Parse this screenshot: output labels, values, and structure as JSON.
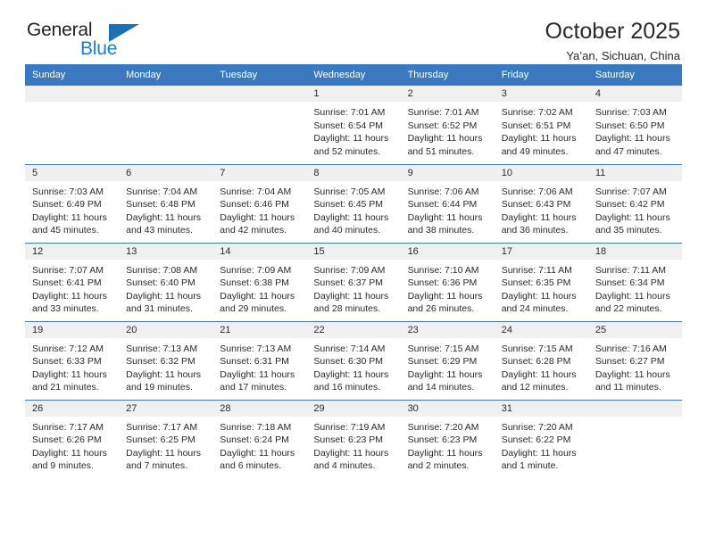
{
  "brand": {
    "name_top": "General",
    "name_bottom": "Blue",
    "triangle_color": "#1b6fb5",
    "blue_color": "#1b7fd0",
    "dark_color": "#231f20"
  },
  "header": {
    "title": "October 2025",
    "subtitle": "Ya’an, Sichuan, China"
  },
  "theme": {
    "header_row_bg": "#3a79c0",
    "header_row_text": "#ffffff",
    "daynum_band_bg": "#f0f0f0",
    "cell_border": "#3a79c0",
    "text": "#2a2a2a"
  },
  "calendar": {
    "weekday_headers": [
      "Sunday",
      "Monday",
      "Tuesday",
      "Wednesday",
      "Thursday",
      "Friday",
      "Saturday"
    ],
    "labels": {
      "sunrise": "Sunrise:",
      "sunset": "Sunset:",
      "daylight": "Daylight:"
    },
    "weeks": [
      [
        {
          "day": "",
          "sunrise": "",
          "sunset": "",
          "daylight": "",
          "empty": true
        },
        {
          "day": "",
          "sunrise": "",
          "sunset": "",
          "daylight": "",
          "empty": true
        },
        {
          "day": "",
          "sunrise": "",
          "sunset": "",
          "daylight": "",
          "empty": true
        },
        {
          "day": "1",
          "sunrise": "Sunrise: 7:01 AM",
          "sunset": "Sunset: 6:54 PM",
          "daylight": "Daylight: 11 hours and 52 minutes."
        },
        {
          "day": "2",
          "sunrise": "Sunrise: 7:01 AM",
          "sunset": "Sunset: 6:52 PM",
          "daylight": "Daylight: 11 hours and 51 minutes."
        },
        {
          "day": "3",
          "sunrise": "Sunrise: 7:02 AM",
          "sunset": "Sunset: 6:51 PM",
          "daylight": "Daylight: 11 hours and 49 minutes."
        },
        {
          "day": "4",
          "sunrise": "Sunrise: 7:03 AM",
          "sunset": "Sunset: 6:50 PM",
          "daylight": "Daylight: 11 hours and 47 minutes."
        }
      ],
      [
        {
          "day": "5",
          "sunrise": "Sunrise: 7:03 AM",
          "sunset": "Sunset: 6:49 PM",
          "daylight": "Daylight: 11 hours and 45 minutes."
        },
        {
          "day": "6",
          "sunrise": "Sunrise: 7:04 AM",
          "sunset": "Sunset: 6:48 PM",
          "daylight": "Daylight: 11 hours and 43 minutes."
        },
        {
          "day": "7",
          "sunrise": "Sunrise: 7:04 AM",
          "sunset": "Sunset: 6:46 PM",
          "daylight": "Daylight: 11 hours and 42 minutes."
        },
        {
          "day": "8",
          "sunrise": "Sunrise: 7:05 AM",
          "sunset": "Sunset: 6:45 PM",
          "daylight": "Daylight: 11 hours and 40 minutes."
        },
        {
          "day": "9",
          "sunrise": "Sunrise: 7:06 AM",
          "sunset": "Sunset: 6:44 PM",
          "daylight": "Daylight: 11 hours and 38 minutes."
        },
        {
          "day": "10",
          "sunrise": "Sunrise: 7:06 AM",
          "sunset": "Sunset: 6:43 PM",
          "daylight": "Daylight: 11 hours and 36 minutes."
        },
        {
          "day": "11",
          "sunrise": "Sunrise: 7:07 AM",
          "sunset": "Sunset: 6:42 PM",
          "daylight": "Daylight: 11 hours and 35 minutes."
        }
      ],
      [
        {
          "day": "12",
          "sunrise": "Sunrise: 7:07 AM",
          "sunset": "Sunset: 6:41 PM",
          "daylight": "Daylight: 11 hours and 33 minutes."
        },
        {
          "day": "13",
          "sunrise": "Sunrise: 7:08 AM",
          "sunset": "Sunset: 6:40 PM",
          "daylight": "Daylight: 11 hours and 31 minutes."
        },
        {
          "day": "14",
          "sunrise": "Sunrise: 7:09 AM",
          "sunset": "Sunset: 6:38 PM",
          "daylight": "Daylight: 11 hours and 29 minutes."
        },
        {
          "day": "15",
          "sunrise": "Sunrise: 7:09 AM",
          "sunset": "Sunset: 6:37 PM",
          "daylight": "Daylight: 11 hours and 28 minutes."
        },
        {
          "day": "16",
          "sunrise": "Sunrise: 7:10 AM",
          "sunset": "Sunset: 6:36 PM",
          "daylight": "Daylight: 11 hours and 26 minutes."
        },
        {
          "day": "17",
          "sunrise": "Sunrise: 7:11 AM",
          "sunset": "Sunset: 6:35 PM",
          "daylight": "Daylight: 11 hours and 24 minutes."
        },
        {
          "day": "18",
          "sunrise": "Sunrise: 7:11 AM",
          "sunset": "Sunset: 6:34 PM",
          "daylight": "Daylight: 11 hours and 22 minutes."
        }
      ],
      [
        {
          "day": "19",
          "sunrise": "Sunrise: 7:12 AM",
          "sunset": "Sunset: 6:33 PM",
          "daylight": "Daylight: 11 hours and 21 minutes."
        },
        {
          "day": "20",
          "sunrise": "Sunrise: 7:13 AM",
          "sunset": "Sunset: 6:32 PM",
          "daylight": "Daylight: 11 hours and 19 minutes."
        },
        {
          "day": "21",
          "sunrise": "Sunrise: 7:13 AM",
          "sunset": "Sunset: 6:31 PM",
          "daylight": "Daylight: 11 hours and 17 minutes."
        },
        {
          "day": "22",
          "sunrise": "Sunrise: 7:14 AM",
          "sunset": "Sunset: 6:30 PM",
          "daylight": "Daylight: 11 hours and 16 minutes."
        },
        {
          "day": "23",
          "sunrise": "Sunrise: 7:15 AM",
          "sunset": "Sunset: 6:29 PM",
          "daylight": "Daylight: 11 hours and 14 minutes."
        },
        {
          "day": "24",
          "sunrise": "Sunrise: 7:15 AM",
          "sunset": "Sunset: 6:28 PM",
          "daylight": "Daylight: 11 hours and 12 minutes."
        },
        {
          "day": "25",
          "sunrise": "Sunrise: 7:16 AM",
          "sunset": "Sunset: 6:27 PM",
          "daylight": "Daylight: 11 hours and 11 minutes."
        }
      ],
      [
        {
          "day": "26",
          "sunrise": "Sunrise: 7:17 AM",
          "sunset": "Sunset: 6:26 PM",
          "daylight": "Daylight: 11 hours and 9 minutes."
        },
        {
          "day": "27",
          "sunrise": "Sunrise: 7:17 AM",
          "sunset": "Sunset: 6:25 PM",
          "daylight": "Daylight: 11 hours and 7 minutes."
        },
        {
          "day": "28",
          "sunrise": "Sunrise: 7:18 AM",
          "sunset": "Sunset: 6:24 PM",
          "daylight": "Daylight: 11 hours and 6 minutes."
        },
        {
          "day": "29",
          "sunrise": "Sunrise: 7:19 AM",
          "sunset": "Sunset: 6:23 PM",
          "daylight": "Daylight: 11 hours and 4 minutes."
        },
        {
          "day": "30",
          "sunrise": "Sunrise: 7:20 AM",
          "sunset": "Sunset: 6:23 PM",
          "daylight": "Daylight: 11 hours and 2 minutes."
        },
        {
          "day": "31",
          "sunrise": "Sunrise: 7:20 AM",
          "sunset": "Sunset: 6:22 PM",
          "daylight": "Daylight: 11 hours and 1 minute."
        },
        {
          "day": "",
          "sunrise": "",
          "sunset": "",
          "daylight": "",
          "empty": true
        }
      ]
    ]
  }
}
